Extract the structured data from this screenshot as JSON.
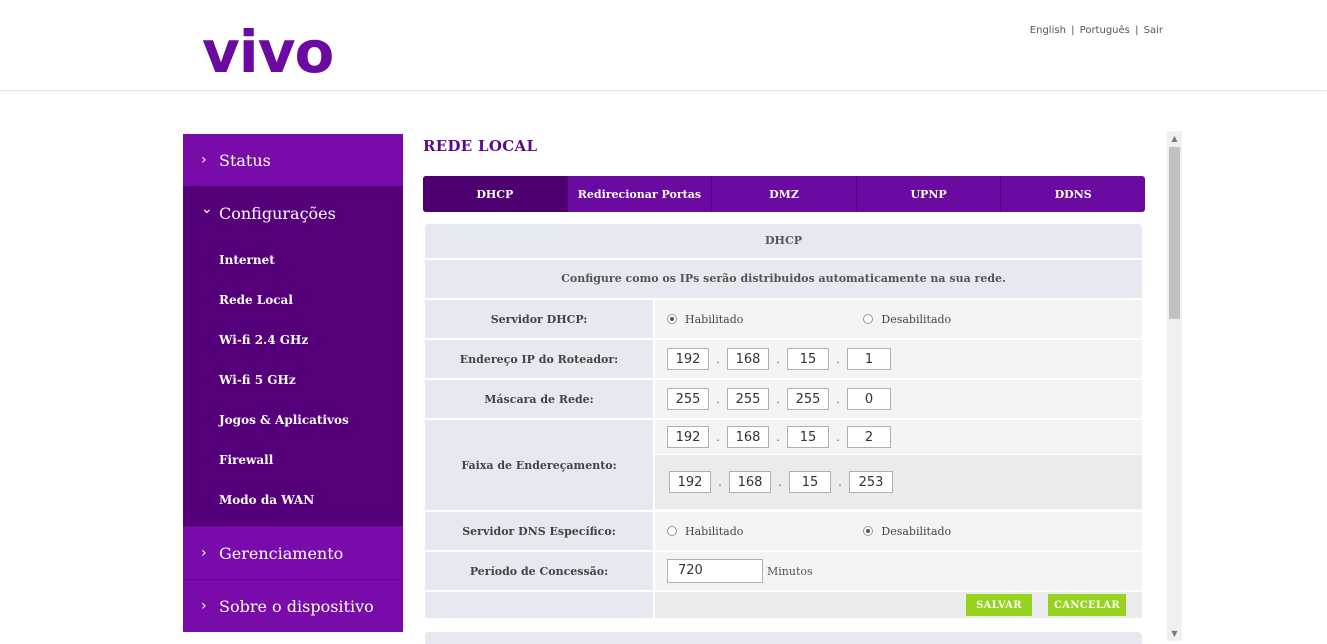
{
  "header": {
    "logo_text": "vivo",
    "links": [
      "English",
      "Português",
      "Sair"
    ],
    "separator": "|"
  },
  "sidebar": {
    "status": "Status",
    "configuracoes": "Configurações",
    "sub_items": [
      "Internet",
      "Rede Local",
      "Wi-fi 2.4 GHz",
      "Wi-fi 5 GHz",
      "Jogos & Aplicativos",
      "Firewall",
      "Modo da WAN"
    ],
    "gerenciamento": "Gerenciamento",
    "sobre": "Sobre o dispositivo",
    "chevron_closed": "›",
    "chevron_open": "⌄"
  },
  "main": {
    "title": "REDE LOCAL",
    "tabs": [
      "DHCP",
      "Redirecionar Portas",
      "DMZ",
      "UPNP",
      "DDNS"
    ],
    "active_tab": "DHCP"
  },
  "dhcp": {
    "section_title": "DHCP",
    "description": "Configure como os IPs serão distribuidos automaticamente na sua rede.",
    "server_label": "Servidor DHCP:",
    "enabled_label": "Habilitado",
    "disabled_label": "Desabilitado",
    "server_state": "enabled",
    "router_ip_label": "Endereço IP do Roteador:",
    "router_ip": [
      "192",
      "168",
      "15",
      "1"
    ],
    "mask_label": "Máscara de Rede:",
    "mask": [
      "255",
      "255",
      "255",
      "0"
    ],
    "range_label": "Faixa de Endereçamento:",
    "range_start": [
      "192",
      "168",
      "15",
      "2"
    ],
    "range_end": [
      "192",
      "168",
      "15",
      "253"
    ],
    "ip_separator": ".",
    "dns_label": "Servidor DNS Específico:",
    "dns_state": "disabled",
    "lease_label": "Período de Concessão:",
    "lease_value": "720",
    "lease_unit": "Minutos",
    "save_label": "SALVAR",
    "cancel_label": "CANCELAR"
  },
  "colors": {
    "brand_purple": "#6a0aa0",
    "sidebar_dark": "#55007a",
    "button_green": "#96d21e"
  }
}
